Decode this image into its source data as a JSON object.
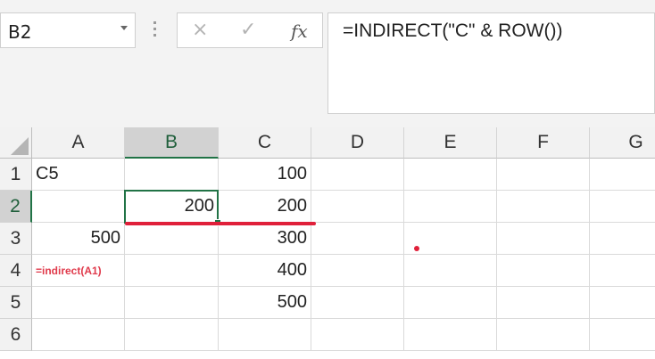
{
  "name_box": {
    "value": "B2"
  },
  "formula_bar": {
    "cancel_icon": "×",
    "enter_icon": "✓",
    "fx_label": "fx",
    "formula": "=INDIRECT(\"C\" & ROW())"
  },
  "columns": [
    "A",
    "B",
    "C",
    "D",
    "E",
    "F",
    "G"
  ],
  "selected_column": "B",
  "rows": [
    "1",
    "2",
    "3",
    "4",
    "5",
    "6"
  ],
  "selected_row": "2",
  "cells": {
    "A1": "C5",
    "C1": "100",
    "B2": "200",
    "C2": "200",
    "A3": "500",
    "C3": "300",
    "A4": "=indirect(A1)",
    "C4": "400",
    "C5": "500"
  },
  "annotation_color": "#e0203a",
  "accent_color": "#217346"
}
